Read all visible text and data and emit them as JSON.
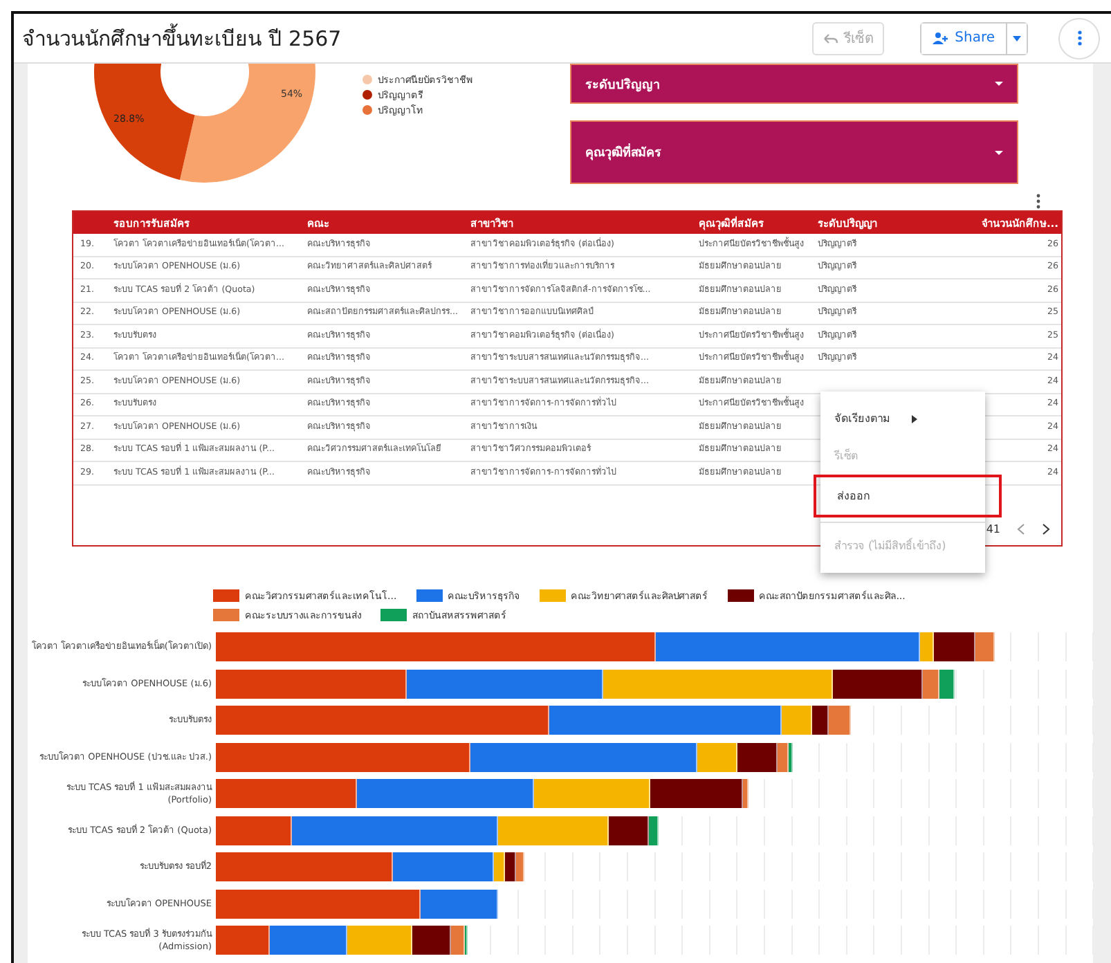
{
  "title": "จำนวนนักศึกษาขึ้นทะเบียน ปี 2567",
  "toolbar": {
    "reset": {
      "label": "รีเซ็ต",
      "disabled": true
    },
    "share": {
      "label": "Share"
    }
  },
  "donut": {
    "labels": [
      {
        "text": "54%"
      },
      {
        "text": "28.8%"
      }
    ],
    "legend": [
      {
        "label": "ประกาศนียบัตรวิชาชีพ",
        "color": "#f6c7a8"
      },
      {
        "label": "ปริญญาตรี",
        "color": "#b02000"
      },
      {
        "label": "ปริญญาโท",
        "color": "#e8733a"
      }
    ]
  },
  "filters": [
    {
      "label": "ระดับปริญญา"
    },
    {
      "label": "คุณวุฒิที่สมัคร"
    }
  ],
  "table": {
    "columns": [
      "รอบการรับสมัคร",
      "คณะ",
      "สาขาวิชา",
      "คุณวุฒิที่สมัคร",
      "ระดับปริญญา",
      "จำนวนนักศึกษ..."
    ],
    "rows": [
      {
        "index": "19.",
        "round": "โควตา โควตาเครือข่ายอินเทอร์เน็ต(โควตา...",
        "faculty": "คณะบริหารธุรกิจ",
        "major": "สาขาวิชาคอมพิวเตอร์ธุรกิจ (ต่อเนื่อง)",
        "qualification": "ประกาศนียบัตรวิชาชีพชั้นสูง",
        "degree": "ปริญญาตรี",
        "count": "26"
      },
      {
        "index": "20.",
        "round": "ระบบโควตา OPENHOUSE (ม.6)",
        "faculty": "คณะวิทยาศาสตร์และศิลปศาสตร์",
        "major": "สาขาวิชาการท่องเที่ยวและการบริการ",
        "qualification": "มัธยมศึกษาตอนปลาย",
        "degree": "ปริญญาตรี",
        "count": "26"
      },
      {
        "index": "21.",
        "round": "ระบบ TCAS รอบที่ 2 โควต้า (Quota)",
        "faculty": "คณะบริหารธุรกิจ",
        "major": "สาขาวิชาการจัดการโลจิสติกส์-การจัดการโซ...",
        "qualification": "มัธยมศึกษาตอนปลาย",
        "degree": "ปริญญาตรี",
        "count": "26"
      },
      {
        "index": "22.",
        "round": "ระบบโควตา OPENHOUSE (ม.6)",
        "faculty": "คณะสถาปัตยกรรมศาสตร์และศิลปกรร...",
        "major": "สาขาวิชาการออกแบบนิเทศศิลป์",
        "qualification": "มัธยมศึกษาตอนปลาย",
        "degree": "ปริญญาตรี",
        "count": "25"
      },
      {
        "index": "23.",
        "round": "ระบบรับตรง",
        "faculty": "คณะบริหารธุรกิจ",
        "major": "สาขาวิชาคอมพิวเตอร์ธุรกิจ (ต่อเนื่อง)",
        "qualification": "ประกาศนียบัตรวิชาชีพชั้นสูง",
        "degree": "ปริญญาตรี",
        "count": "25"
      },
      {
        "index": "24.",
        "round": "โควตา โควตาเครือข่ายอินเทอร์เน็ต(โควตา...",
        "faculty": "คณะบริหารธุรกิจ",
        "major": "สาขาวิชาระบบสารสนเทศและนวัตกรรมธุรกิจ...",
        "qualification": "ประกาศนียบัตรวิชาชีพชั้นสูง",
        "degree": "ปริญญาตรี",
        "count": "24"
      },
      {
        "index": "25.",
        "round": "ระบบโควตา OPENHOUSE (ม.6)",
        "faculty": "คณะบริหารธุรกิจ",
        "major": "สาขาวิชาระบบสารสนเทศและนวัตกรรมธุรกิจ...",
        "qualification": "มัธยมศึกษาตอนปลาย",
        "count": "24"
      },
      {
        "index": "26.",
        "round": "ระบบรับตรง",
        "faculty": "คณะบริหารธุรกิจ",
        "major": "สาขาวิชาการจัดการ-การจัดการทั่วไป",
        "qualification": "ประกาศนียบัตรวิชาชีพชั้นสูง",
        "count": "24"
      },
      {
        "index": "27.",
        "round": "ระบบโควตา OPENHOUSE (ม.6)",
        "faculty": "คณะบริหารธุรกิจ",
        "major": "สาขาวิชาการเงิน",
        "qualification": "มัธยมศึกษาตอนปลาย",
        "count": "24"
      },
      {
        "index": "28.",
        "round": "ระบบ TCAS รอบที่ 1 แฟ้มสะสมผลงาน (P...",
        "faculty": "คณะวิศวกรรมศาสตร์และเทคโนโลยี",
        "major": "สาขาวิชาวิศวกรรมคอมพิวเตอร์",
        "qualification": "มัธยมศึกษาตอนปลาย",
        "count": "24"
      },
      {
        "index": "29.",
        "round": "ระบบ TCAS รอบที่ 1 แฟ้มสะสมผลงาน (P...",
        "faculty": "คณะบริหารธุรกิจ",
        "major": "สาขาวิชาการจัดการ-การจัดการทั่วไป",
        "qualification": "มัธยมศึกษาตอนปลาย",
        "count": "24"
      }
    ],
    "pager": "41"
  },
  "context_menu": {
    "items": [
      {
        "label": "จัดเรียงตาม",
        "kind": "submenu",
        "disabled": false,
        "highlighted": false
      },
      {
        "label": "รีเซ็ต",
        "kind": "action",
        "disabled": true,
        "highlighted": false
      },
      {
        "label": "ส่งออก",
        "kind": "action",
        "disabled": false,
        "highlighted": true
      },
      {
        "label": "สำรวจ (ไม่มีสิทธิ์เข้าถึง)",
        "kind": "action",
        "disabled": true,
        "highlighted": false
      }
    ]
  },
  "bar_chart": {
    "legend": [
      {
        "label": "คณะวิศวกรรมศาสตร์และเทคโนโ...",
        "color": "#dc3b0c"
      },
      {
        "label": "คณะบริหารธุรกิจ",
        "color": "#1d73e8"
      },
      {
        "label": "คณะวิทยาศาสตร์และศิลปศาสตร์",
        "color": "#f4b400"
      },
      {
        "label": "คณะสถาปัตยกรรมศาสตร์และศิล...",
        "color": "#6e0000"
      },
      {
        "label": "คณะระบบรางและการขนส่ง",
        "color": "#e6773a"
      },
      {
        "label": "สถาบันสหสรรพศาสตร์",
        "color": "#10a05a"
      }
    ],
    "categories": [
      "โควตา โควตาเครือข่ายอินเทอร์เน็ต(โควตาเปิด)",
      "ระบบโควตา OPENHOUSE (ม.6)",
      "ระบบรับตรง",
      "ระบบโควตา OPENHOUSE (ปวช.และ ปวส.)",
      "ระบบ TCAS รอบที่ 1 แฟ้มสะสมผลงาน (Portfolio)",
      "ระบบ TCAS รอบที่ 2 โควต้า (Quota)",
      "ระบบรับตรง รอบที่2",
      "ระบบโควตา OPENHOUSE",
      "ระบบ TCAS รอบที่ 3 รับตรงร่วมกัน (Admission)"
    ]
  }
}
